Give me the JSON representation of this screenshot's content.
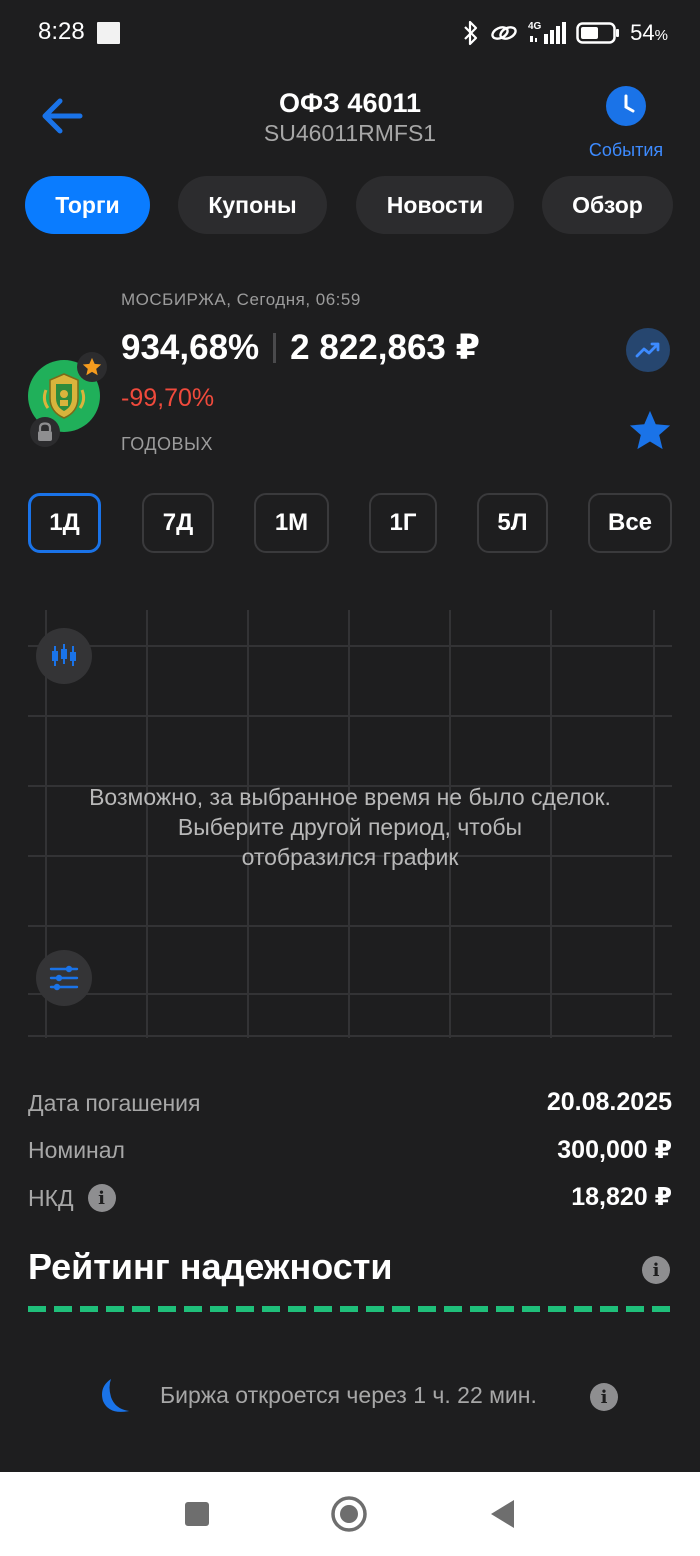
{
  "status_bar": {
    "time": "8:28",
    "network": "4G",
    "battery_percent": "54",
    "battery_unit": "%",
    "battery_level": 0.54
  },
  "header": {
    "title": "ОФЗ 46011",
    "subtitle": "SU46011RMFS1",
    "events_label": "События"
  },
  "tabs": [
    {
      "label": "Торги",
      "active": true
    },
    {
      "label": "Купоны",
      "active": false
    },
    {
      "label": "Новости",
      "active": false
    },
    {
      "label": "Обзор",
      "active": false
    }
  ],
  "quote": {
    "exchange": "МОСБИРЖА, Сегодня, 06:59",
    "yield": "934,68%",
    "price": "2 822,863 ₽",
    "change": "-99,70%",
    "yield_label": "ГОДОВЫХ"
  },
  "periods": [
    {
      "label": "1Д",
      "active": true
    },
    {
      "label": "7Д",
      "active": false
    },
    {
      "label": "1М",
      "active": false
    },
    {
      "label": "1Г",
      "active": false
    },
    {
      "label": "5Л",
      "active": false
    },
    {
      "label": "Все",
      "active": false
    }
  ],
  "chart": {
    "message_line1": "Возможно, за выбранное время не было сделок.",
    "message_line2": "Выберите другой период, чтобы",
    "message_line3": "отобразился график"
  },
  "details": [
    {
      "label": "Дата погашения",
      "value": "20.08.2025",
      "info": false
    },
    {
      "label": "Номинал",
      "value": "300,000 ₽",
      "info": false
    },
    {
      "label": "НКД",
      "value": "18,820 ₽",
      "info": true
    }
  ],
  "rating": {
    "title": "Рейтинг надежности",
    "info_glyph": "i"
  },
  "market_status": {
    "text": "Биржа откроется через 1 ч. 22 мин.",
    "info_glyph": "i"
  },
  "colors": {
    "background": "#1e1e1f",
    "accent": "#0a7cff",
    "negative": "#f04a3c",
    "rating": "#1fbf7a"
  }
}
